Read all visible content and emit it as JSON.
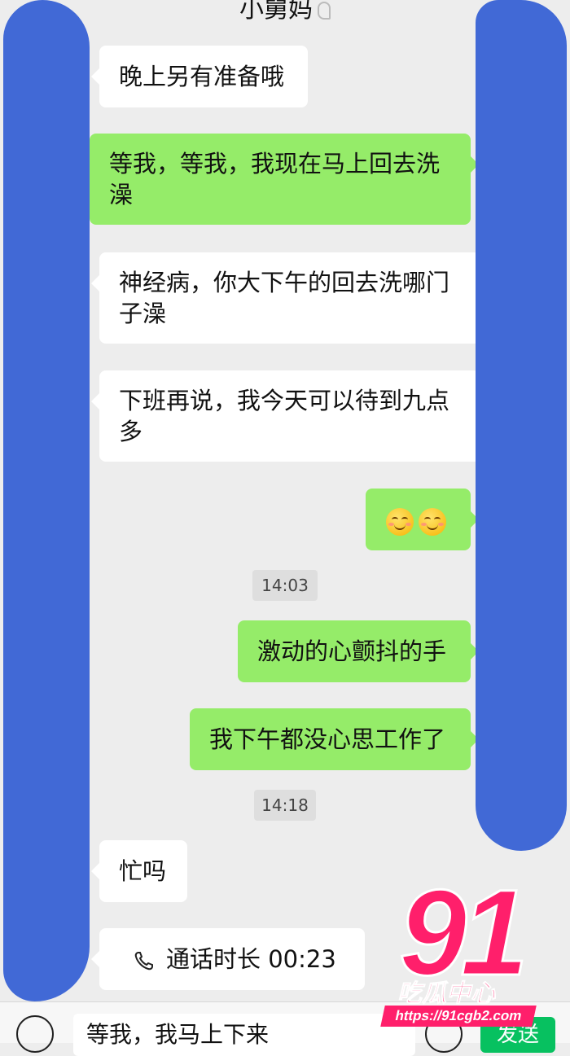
{
  "header": {
    "title": "小舅妈"
  },
  "messages": [
    {
      "side": "in",
      "text": "晚上另有准备哦"
    },
    {
      "side": "out",
      "line1": "等我，等我，我现在马上回去洗",
      "line2": "澡"
    },
    {
      "side": "in",
      "line1": "神经病，你大下午的回去洗哪门",
      "line2": "子澡"
    },
    {
      "side": "in",
      "line1": "下班再说，我今天可以待到九点",
      "line2": "多"
    },
    {
      "side": "out",
      "emoji": [
        "smiling-blush-emoji",
        "smiling-blush-emoji"
      ]
    },
    {
      "time": "14:03"
    },
    {
      "side": "out",
      "text": "激动的心颤抖的手"
    },
    {
      "side": "out",
      "text": "我下午都没心思工作了"
    },
    {
      "time": "14:18"
    },
    {
      "side": "in",
      "text": "忙吗"
    },
    {
      "side": "in",
      "text": "通话时长 00:23",
      "icon": "phone-call-icon"
    }
  ],
  "input": {
    "value": "等我，我马上下来",
    "send_label": "发送"
  },
  "watermark": {
    "number": "91",
    "name": "吃瓜中心",
    "url": "https://91cgb2.com"
  },
  "colors": {
    "outgoing": "#95ec69",
    "incoming": "#ffffff",
    "redaction": "#4169d6",
    "send": "#07c160"
  }
}
